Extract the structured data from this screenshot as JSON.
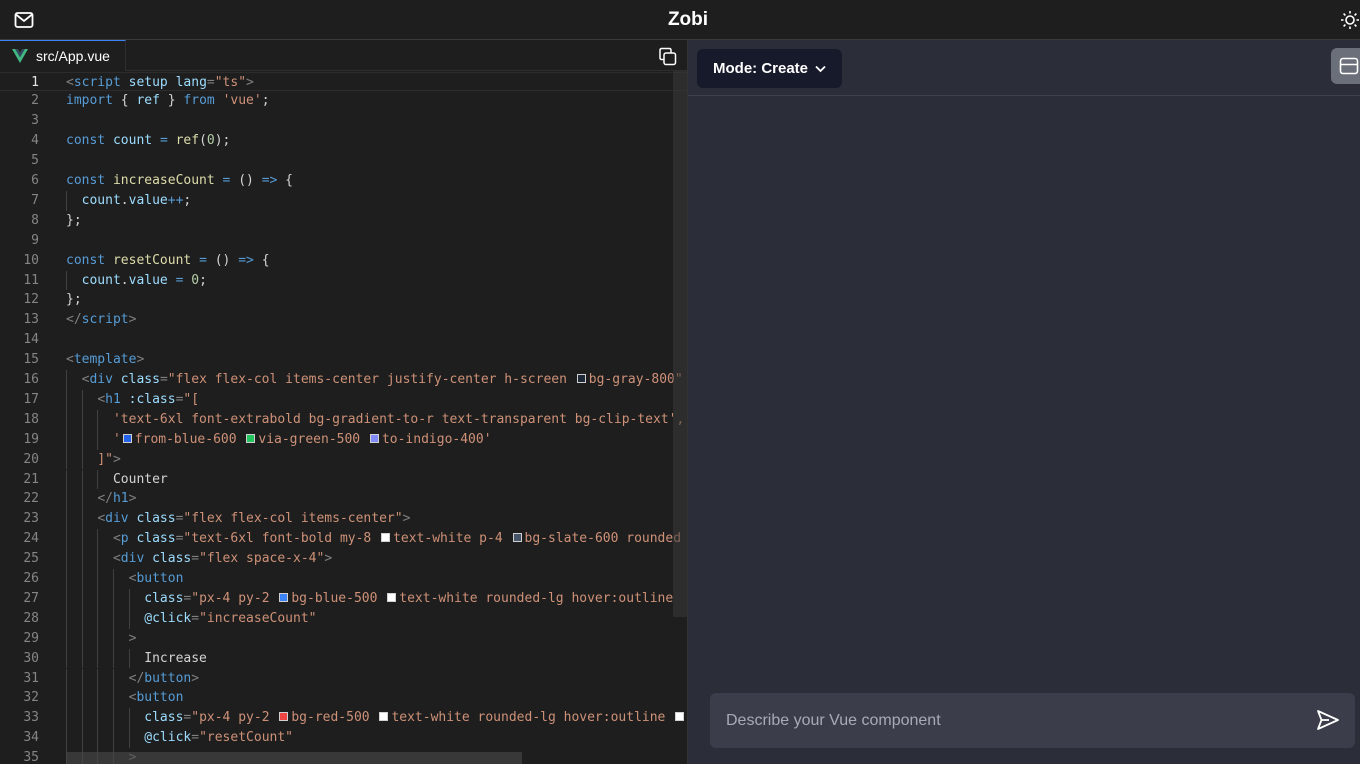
{
  "app": {
    "title": "Zobi"
  },
  "icons": {
    "mail": "mail-icon",
    "theme": "sun-icon",
    "vue": "vue-logo-icon",
    "copy": "copy-icon",
    "chevron": "chevron-down-icon",
    "layout": "layout-panel-icon",
    "send": "send-icon"
  },
  "editor": {
    "tab_label": "src/App.vue",
    "active_line": 1,
    "lines": [
      {
        "n": "1",
        "indent": 0,
        "html": "<span class=\"p\">&lt;</span><span class=\"t\">script</span> <span class=\"a\">setup</span> <span class=\"a\">lang</span><span class=\"p\">=</span><span class=\"s\">\"ts\"</span><span class=\"p\">&gt;</span>"
      },
      {
        "n": "2",
        "indent": 0,
        "html": "<span class=\"k\">import</span> { <span class=\"v\">ref</span> } <span class=\"k\">from</span> <span class=\"s\">'vue'</span>;"
      },
      {
        "n": "3",
        "indent": 0,
        "html": ""
      },
      {
        "n": "4",
        "indent": 0,
        "html": "<span class=\"k\">const</span> <span class=\"v\">count</span> <span class=\"k\">=</span> <span class=\"fn\">ref</span>(<span class=\"n\">0</span>);"
      },
      {
        "n": "5",
        "indent": 0,
        "html": ""
      },
      {
        "n": "6",
        "indent": 0,
        "html": "<span class=\"k\">const</span> <span class=\"fn\">increaseCount</span> <span class=\"k\">=</span> () <span class=\"k\">=&gt;</span> {"
      },
      {
        "n": "7",
        "indent": 1,
        "html": "  <span class=\"v\">count</span>.<span class=\"v\">value</span><span class=\"k\">++</span>;"
      },
      {
        "n": "8",
        "indent": 0,
        "html": "};"
      },
      {
        "n": "9",
        "indent": 0,
        "html": ""
      },
      {
        "n": "10",
        "indent": 0,
        "html": "<span class=\"k\">const</span> <span class=\"fn\">resetCount</span> <span class=\"k\">=</span> () <span class=\"k\">=&gt;</span> {"
      },
      {
        "n": "11",
        "indent": 1,
        "html": "  <span class=\"v\">count</span>.<span class=\"v\">value</span> <span class=\"k\">=</span> <span class=\"n\">0</span>;"
      },
      {
        "n": "12",
        "indent": 0,
        "html": "};"
      },
      {
        "n": "13",
        "indent": 0,
        "html": "<span class=\"p\">&lt;/</span><span class=\"t\">script</span><span class=\"p\">&gt;</span>"
      },
      {
        "n": "14",
        "indent": 0,
        "html": ""
      },
      {
        "n": "15",
        "indent": 0,
        "html": "<span class=\"p\">&lt;</span><span class=\"t\">template</span><span class=\"p\">&gt;</span>"
      },
      {
        "n": "16",
        "indent": 1,
        "html": "  <span class=\"p\">&lt;</span><span class=\"t\">div</span> <span class=\"a\">class</span><span class=\"p\">=</span><span class=\"s\">\"flex flex-col items-center justify-center h-screen <span class=\"sw\" style=\"background:#1f2937\"></span>bg-gray-800\"</span>"
      },
      {
        "n": "17",
        "indent": 2,
        "html": "    <span class=\"p\">&lt;</span><span class=\"t\">h1</span> <span class=\"a\">:class</span><span class=\"p\">=</span><span class=\"s\">\"[</span>"
      },
      {
        "n": "18",
        "indent": 3,
        "html": "      <span class=\"s\">'text-6xl font-extrabold bg-gradient-to-r text-transparent bg-clip-text',</span>"
      },
      {
        "n": "19",
        "indent": 3,
        "html": "      <span class=\"s\">'<span class=\"sw\" style=\"background:#2563eb\"></span>from-blue-600 <span class=\"sw\" style=\"background:#22c55e\"></span>via-green-500 <span class=\"sw\" style=\"background:#818cf8\"></span>to-indigo-400'</span>"
      },
      {
        "n": "20",
        "indent": 2,
        "html": "    <span class=\"s\">]\"</span><span class=\"p\">&gt;</span>"
      },
      {
        "n": "21",
        "indent": 3,
        "html": "      Counter"
      },
      {
        "n": "22",
        "indent": 2,
        "html": "    <span class=\"p\">&lt;/</span><span class=\"t\">h1</span><span class=\"p\">&gt;</span>"
      },
      {
        "n": "23",
        "indent": 2,
        "html": "    <span class=\"p\">&lt;</span><span class=\"t\">div</span> <span class=\"a\">class</span><span class=\"p\">=</span><span class=\"s\">\"flex flex-col items-center\"</span><span class=\"p\">&gt;</span>"
      },
      {
        "n": "24",
        "indent": 3,
        "html": "      <span class=\"p\">&lt;</span><span class=\"t\">p</span> <span class=\"a\">class</span><span class=\"p\">=</span><span class=\"s\">\"text-6xl font-bold my-8 <span class=\"sw\" style=\"background:#ffffff\"></span>text-white p-4 <span class=\"sw\" style=\"background:#475569\"></span>bg-slate-600 rounded</span>"
      },
      {
        "n": "25",
        "indent": 3,
        "html": "      <span class=\"p\">&lt;</span><span class=\"t\">div</span> <span class=\"a\">class</span><span class=\"p\">=</span><span class=\"s\">\"flex space-x-4\"</span><span class=\"p\">&gt;</span>"
      },
      {
        "n": "26",
        "indent": 4,
        "html": "        <span class=\"p\">&lt;</span><span class=\"t\">button</span>"
      },
      {
        "n": "27",
        "indent": 5,
        "html": "          <span class=\"a\">class</span><span class=\"p\">=</span><span class=\"s\">\"px-4 py-2 <span class=\"sw\" style=\"background:#3b82f6\"></span>bg-blue-500 <span class=\"sw\" style=\"background:#ffffff\"></span>text-white rounded-lg hover:outline</span>"
      },
      {
        "n": "28",
        "indent": 5,
        "html": "          <span class=\"a\">@click</span><span class=\"p\">=</span><span class=\"s\">\"increaseCount\"</span>"
      },
      {
        "n": "29",
        "indent": 4,
        "html": "        <span class=\"p\">&gt;</span>"
      },
      {
        "n": "30",
        "indent": 5,
        "html": "          Increase"
      },
      {
        "n": "31",
        "indent": 4,
        "html": "        <span class=\"p\">&lt;/</span><span class=\"t\">button</span><span class=\"p\">&gt;</span>"
      },
      {
        "n": "32",
        "indent": 4,
        "html": "        <span class=\"p\">&lt;</span><span class=\"t\">button</span>"
      },
      {
        "n": "33",
        "indent": 5,
        "html": "          <span class=\"a\">class</span><span class=\"p\">=</span><span class=\"s\">\"px-4 py-2 <span class=\"sw\" style=\"background:#ef4444\"></span>bg-red-500 <span class=\"sw\" style=\"background:#ffffff\"></span>text-white rounded-lg hover:outline <span class=\"sw\" style=\"background:#ffffff\"></span></span>"
      },
      {
        "n": "34",
        "indent": 5,
        "html": "          <span class=\"a\">@click</span><span class=\"p\">=</span><span class=\"s\">\"resetCount\"</span>"
      },
      {
        "n": "35",
        "indent": 4,
        "html": "        <span class=\"p\">&gt;</span>"
      }
    ]
  },
  "panel": {
    "mode_label": "Mode: Create",
    "prompt_placeholder": "Describe your Vue component"
  }
}
